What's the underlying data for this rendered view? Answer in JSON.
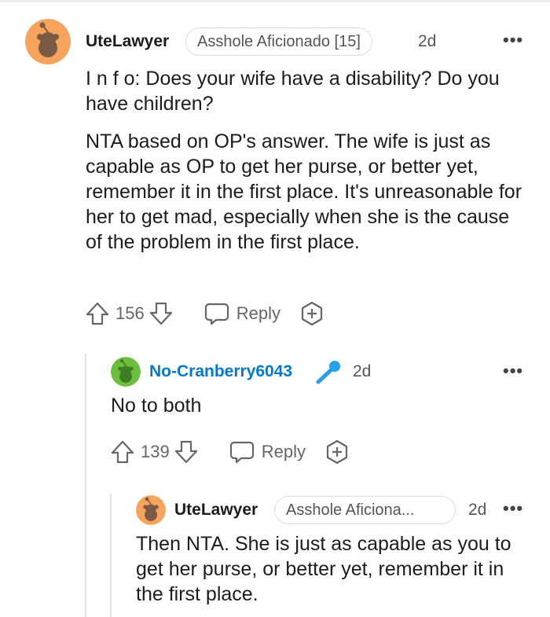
{
  "comments": [
    {
      "username": "UteLawyer",
      "flair": "Asshole Aficionado [15]",
      "time": "2d",
      "paragraphs": [
        "I n f o: Does your wife have a disability? Do you have children?",
        "NTA based on OP's answer. The wife is just as capable as OP to get her purse, or better yet, remember it in the first place. It's unreasonable for her to get mad, especially when she is the cause of the problem in the first place."
      ],
      "votes": "156",
      "reply_label": "Reply",
      "avatar_color": "#f7a35c"
    },
    {
      "username": "No-Cranberry6043",
      "time": "2d",
      "paragraphs": [
        "No to both"
      ],
      "votes": "139",
      "reply_label": "Reply",
      "avatar_color": "#6bbf3c",
      "name_color": "#0079d3",
      "badge_color": "#24a0ed"
    },
    {
      "username": "UteLawyer",
      "flair": "Asshole Aficiona...",
      "time": "2d",
      "paragraphs": [
        "Then NTA. She is just as capable as you to get her purse, or better yet, remember it in the first place."
      ],
      "avatar_color": "#f7a35c"
    }
  ],
  "icons": {
    "more": "more-options-icon",
    "upvote": "upvote-arrow-icon",
    "downvote": "downvote-arrow-icon",
    "reply": "chat-bubble-icon",
    "award": "award-plus-icon",
    "op_badge": "microphone-icon"
  }
}
